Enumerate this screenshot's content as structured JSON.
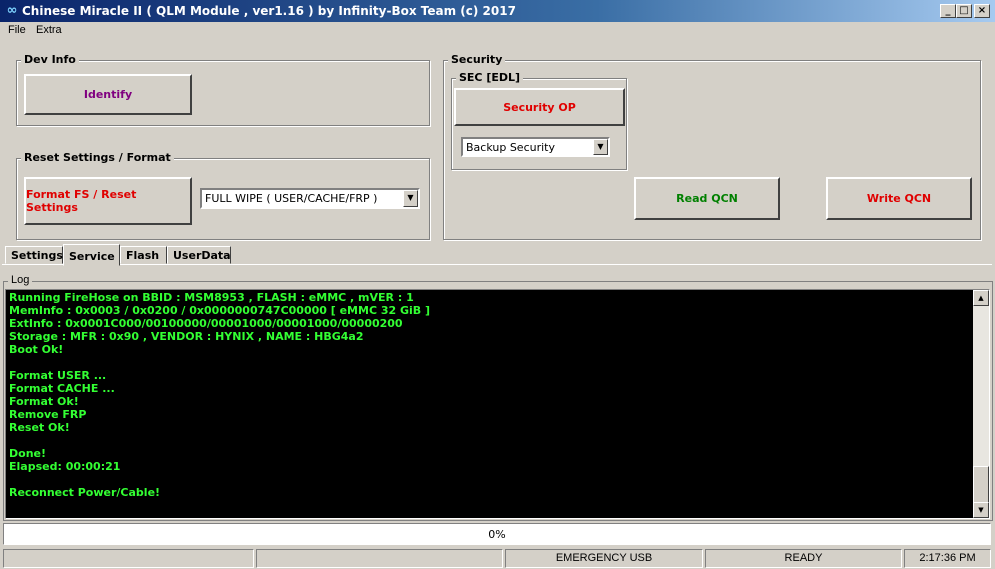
{
  "window": {
    "title": "Chinese Miracle II ( QLM Module , ver1.16  ) by Infinity-Box Team (c) 2017",
    "minimize_glyph": "_",
    "maximize_glyph": "□",
    "close_glyph": "×"
  },
  "menu": [
    "File",
    "Extra"
  ],
  "dev_info": {
    "title": "Dev Info",
    "identify_label": "Identify"
  },
  "reset": {
    "title": "Reset Settings / Format",
    "format_label": "Format FS / Reset Settings",
    "wipe_option": "FULL WIPE ( USER/CACHE/FRP )"
  },
  "security": {
    "title": "Security",
    "sec_title": "SEC [EDL]",
    "security_op_label": "Security OP",
    "backup_option": "Backup Security",
    "read_qcn_label": "Read QCN",
    "write_qcn_label": "Write QCN"
  },
  "tabs": [
    "Settings",
    "Service",
    "Flash",
    "UserData"
  ],
  "active_tab": "Service",
  "log": {
    "title": "Log",
    "lines": [
      "Running FireHose on BBID : MSM8953 , FLASH : eMMC , mVER : 1",
      "MemInfo : 0x0003 / 0x0200 / 0x0000000747C00000 [ eMMC 32 GiB ]",
      "ExtInfo : 0x0001C000/00100000/00001000/00001000/00000200",
      "Storage : MFR : 0x90 , VENDOR : HYNIX , NAME : HBG4a2",
      "Boot Ok!",
      "",
      "Format USER ...",
      "Format CACHE ...",
      "Format Ok!",
      "Remove FRP",
      "Reset Ok!",
      "",
      "Done!",
      "Elapsed: 00:00:21",
      "",
      "Reconnect Power/Cable!"
    ]
  },
  "progress": {
    "value": 0,
    "text": "0%"
  },
  "status": {
    "panel1": "",
    "panel2": "",
    "usb_mode": "EMERGENCY USB",
    "state": "READY",
    "time": "2:17:36 PM"
  },
  "colors": {
    "identify": "#800080",
    "security_op": "#e00000",
    "format": "#e00000",
    "read_qcn": "#008000",
    "write_qcn": "#e00000",
    "log_text": "#33ff33"
  },
  "icons": {
    "app": "infinity-icon",
    "scroll_up": "arrow-up-icon",
    "scroll_down": "arrow-down-icon",
    "combo": "chevron-down-icon"
  }
}
